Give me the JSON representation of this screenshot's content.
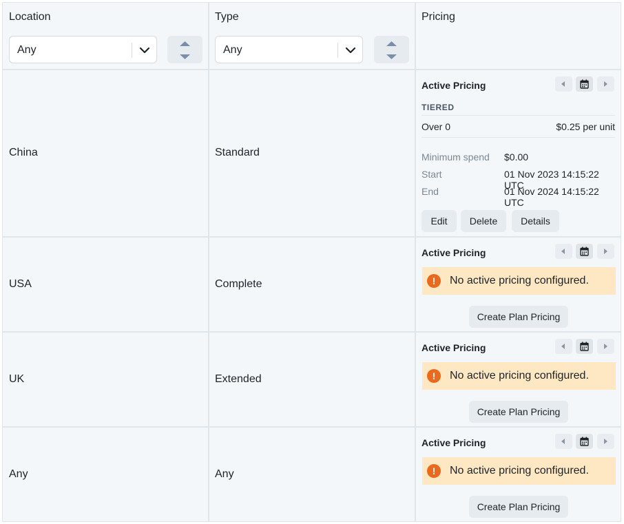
{
  "header": {
    "location_label": "Location",
    "type_label": "Type",
    "pricing_label": "Pricing",
    "location_filter": "Any",
    "type_filter": "Any"
  },
  "rows": [
    {
      "location": "China",
      "type": "Standard",
      "pricing": {
        "title": "Active Pricing",
        "model": "TIERED",
        "tier_label": "Over 0",
        "tier_price": "$0.25 per unit",
        "min_spend_label": "Minimum spend",
        "min_spend_value": "$0.00",
        "start_label": "Start",
        "start_value": "01 Nov 2023 14:15:22 UTC",
        "end_label": "End",
        "end_value": "01 Nov 2024 14:15:22 UTC",
        "edit": "Edit",
        "delete": "Delete",
        "details": "Details"
      }
    },
    {
      "location": "USA",
      "type": "Complete",
      "pricing": {
        "title": "Active Pricing",
        "warning": "No active pricing configured.",
        "create": "Create Plan Pricing"
      }
    },
    {
      "location": "UK",
      "type": "Extended",
      "pricing": {
        "title": "Active Pricing",
        "warning": "No active pricing configured.",
        "create": "Create Plan Pricing"
      }
    },
    {
      "location": "Any",
      "type": "Any",
      "pricing": {
        "title": "Active Pricing",
        "warning": "No active pricing configured.",
        "create": "Create Plan Pricing"
      }
    }
  ],
  "icons": {
    "prev": "caret-left-icon",
    "calendar": "calendar-icon",
    "next": "caret-right-icon",
    "warning": "exclamation-icon",
    "sort": "sort-icon",
    "dropdown": "chevron-down-icon"
  },
  "colors": {
    "cell_bg": "#f3f7fa",
    "warning_bg": "#fde8c3",
    "warning_icon": "#e96a1e"
  }
}
